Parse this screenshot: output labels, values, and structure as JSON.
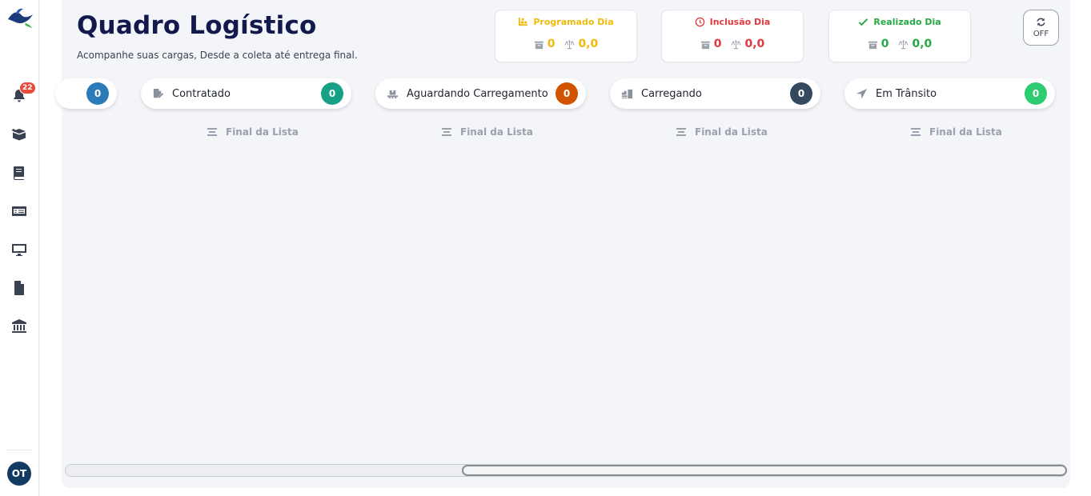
{
  "sidebar": {
    "notifications_count": "22",
    "items": [
      {
        "icon": "bell-icon"
      },
      {
        "icon": "box-open-icon"
      },
      {
        "icon": "book-icon"
      },
      {
        "icon": "money-check-icon"
      },
      {
        "icon": "desktop-icon"
      },
      {
        "icon": "file-icon"
      },
      {
        "icon": "bank-icon"
      }
    ],
    "avatar_initials": "OT"
  },
  "header": {
    "title": "Quadro Logístico",
    "subtitle": "Acompanhe suas cargas, Desde a coleta até entrega final."
  },
  "stats": [
    {
      "label": "Programado Dia",
      "count": "0",
      "weight": "0,0",
      "color": "#f0b90b",
      "icon": "dolly-icon"
    },
    {
      "label": "Inclusão Dia",
      "count": "0",
      "weight": "0,0",
      "color": "#e0393e",
      "icon": "clock-icon"
    },
    {
      "label": "Realizado Dia",
      "count": "0",
      "weight": "0,0",
      "color": "#27a844",
      "icon": "check-icon"
    }
  ],
  "auto_refresh": {
    "state": "OFF"
  },
  "columns": [
    {
      "label": "",
      "count": "0",
      "color": "#2b7bb9"
    },
    {
      "label": "Contratado",
      "count": "0",
      "color": "#16a085",
      "icon": "file-signature-icon"
    },
    {
      "label": "Aguardando Carregamento",
      "count": "0",
      "color": "#d35400",
      "icon": "pallet-icon"
    },
    {
      "label": "Carregando",
      "count": "0",
      "color": "#34495e",
      "icon": "loading-truck-icon"
    },
    {
      "label": "Em Trânsito",
      "count": "0",
      "color": "#2ecc71",
      "icon": "location-arrow-icon"
    }
  ],
  "end_of_list": "Final da Lista",
  "scroll": {
    "position_fraction": 0.4
  }
}
